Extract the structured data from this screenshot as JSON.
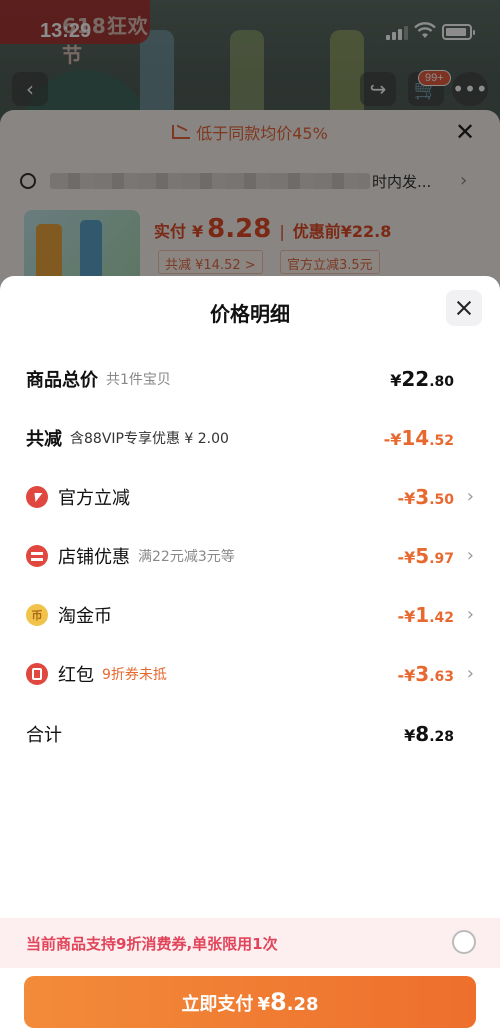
{
  "status": {
    "time": "13:29"
  },
  "background": {
    "promo_tag": "618狂欢节",
    "cart_badge": "99+",
    "low_price_notice": "低于同款均价45%",
    "address_suffix": "时内发...",
    "pay_label": "实付",
    "currency": "¥",
    "pay_amount": "8.28",
    "original_label": "优惠前",
    "original_price": "¥22.8",
    "chip_total_reduction": "共减 ¥14.52 >",
    "chip_official": "官方立减3.5元"
  },
  "sheet": {
    "title": "价格明细",
    "rows": [
      {
        "label": "商品总价",
        "note": "共1件宝贝",
        "currency": "¥",
        "int": "22",
        "dec": ".80"
      },
      {
        "label": "共减",
        "note": "含88VIP专享优惠 ¥ 2.00",
        "currency": "-¥",
        "int": "14",
        "dec": ".52"
      },
      {
        "label": "官方立减",
        "note": "",
        "currency": "-¥",
        "int": "3",
        "dec": ".50",
        "icon": "lightning-icon"
      },
      {
        "label": "店铺优惠",
        "note": "满22元减3元等",
        "currency": "-¥",
        "int": "5",
        "dec": ".97",
        "icon": "store-icon"
      },
      {
        "label": "淘金币",
        "note": "",
        "currency": "-¥",
        "int": "1",
        "dec": ".42",
        "icon": "coin-icon"
      },
      {
        "label": "红包",
        "note": "9折券未抵",
        "currency": "-¥",
        "int": "3",
        "dec": ".63",
        "icon": "red-packet-icon"
      },
      {
        "label": "合计",
        "note": "",
        "currency": "¥",
        "int": "8",
        "dec": ".28"
      }
    ],
    "coin_glyph": "币",
    "voucher_notice": "当前商品支持9折消费券,单张限用1次",
    "pay_button": {
      "label": "立即支付",
      "currency": "¥",
      "int": "8",
      "dec": ".28"
    }
  },
  "colors": {
    "accent_orange": "#e8692f",
    "pay_button": "#ee6f2c",
    "voucher_text": "#e2455a",
    "voucher_bg": "#fdeef0",
    "icon_red": "#e0473f",
    "icon_gold": "#f2c34b"
  }
}
